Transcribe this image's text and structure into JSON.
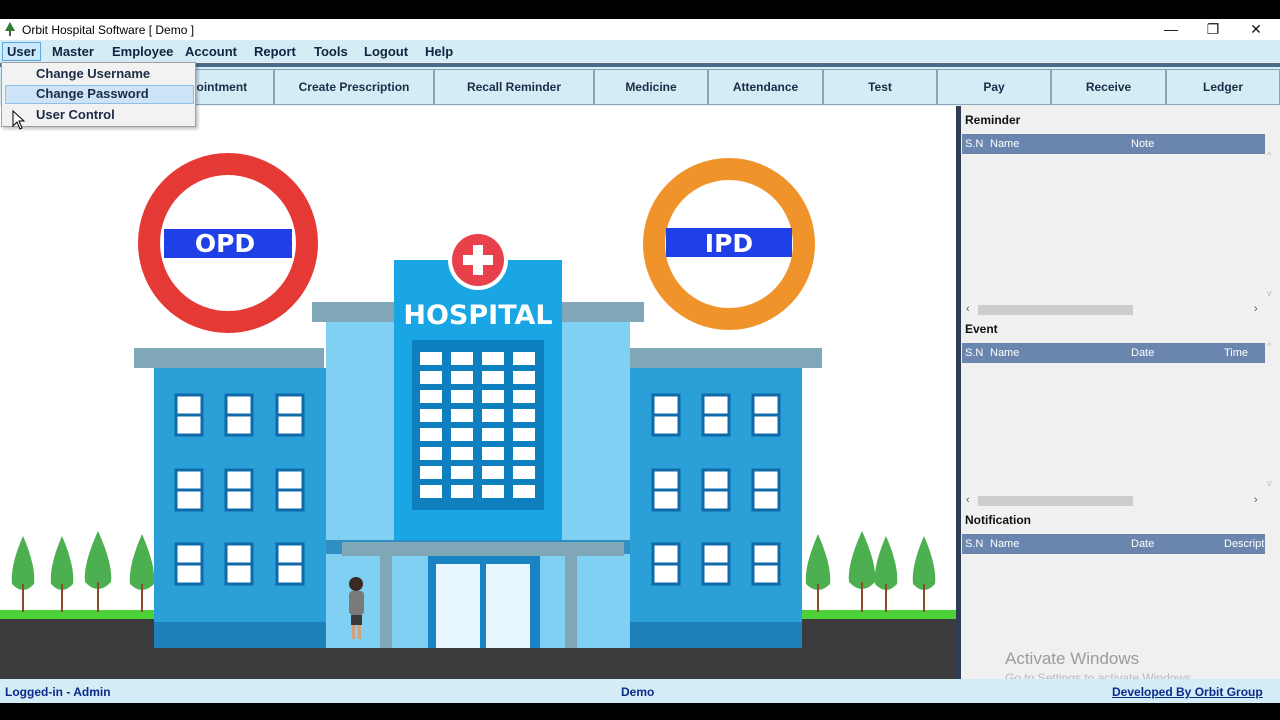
{
  "window": {
    "title": "Orbit Hospital Software  [ Demo ]",
    "controls": {
      "minimize": "—",
      "restore": "❐",
      "close": "✕"
    }
  },
  "menu": {
    "items": [
      "User",
      "Master",
      "Employee",
      "Account",
      "Report",
      "Tools",
      "Logout",
      "Help"
    ],
    "active": "User"
  },
  "user_menu": {
    "items": [
      "Change Username",
      "Change Password",
      "User Control"
    ],
    "hovered": "Change Password"
  },
  "toolbar": {
    "buttons": [
      "ppointment",
      "Create Prescription",
      "Recall Reminder",
      "Medicine",
      "Attendance",
      "Test",
      "Pay",
      "Receive",
      "Ledger"
    ]
  },
  "illustration": {
    "opd_label": "OPD",
    "ipd_label": "IPD",
    "hospital_sign": "HOSPITAL",
    "colors": {
      "opd_ring": "#e53935",
      "ipd_ring": "#f0932b",
      "band": "#1e40e6",
      "building": "#2a9fd8",
      "cross": "#e8414c"
    }
  },
  "panels": {
    "reminder": {
      "title": "Reminder",
      "columns": [
        "S.N",
        "Name",
        "Note"
      ]
    },
    "event": {
      "title": "Event",
      "columns": [
        "S.N",
        "Name",
        "Date",
        "Time"
      ]
    },
    "notification": {
      "title": "Notification",
      "columns": [
        "S.N",
        "Name",
        "Date",
        "Descript"
      ]
    }
  },
  "status": {
    "logged_in": "Logged-in - Admin",
    "mode": "Demo",
    "developer": "Developed By Orbit Group"
  },
  "watermark": {
    "line1": "Activate Windows",
    "line2": "Go to Settings to activate Windows."
  },
  "colors": {
    "accent": "#6a85ae",
    "menubar": "#d4ecf6",
    "status_text": "#0c2a8a"
  }
}
